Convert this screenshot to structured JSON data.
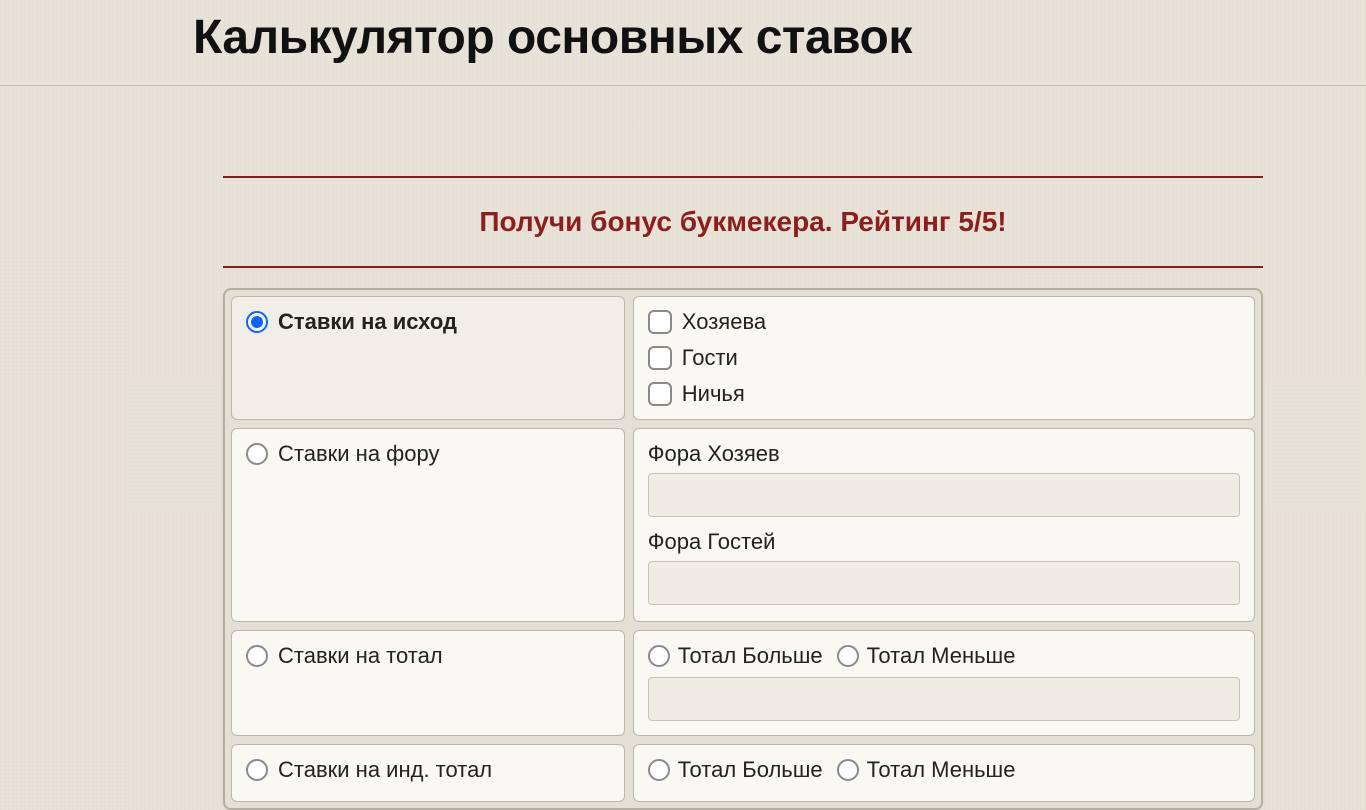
{
  "page": {
    "title": "Калькулятор основных ставок"
  },
  "promo": {
    "text": "Получи бонус букмекера. Рейтинг 5/5!"
  },
  "rows": {
    "outcome": {
      "label": "Ставки на исход",
      "h": "Хозяева",
      "g": "Гости",
      "d": "Ничья"
    },
    "handicap": {
      "label": "Ставки на фору",
      "home_label": "Фора Хозяев",
      "away_label": "Фора Гостей",
      "home_value": "",
      "away_value": ""
    },
    "total": {
      "label": "Ставки на тотал",
      "over": "Тотал Больше",
      "under": "Тотал Меньше",
      "value": ""
    },
    "ind_total": {
      "label": "Ставки на инд. тотал",
      "over": "Тотал Больше",
      "under": "Тотал Меньше"
    }
  }
}
